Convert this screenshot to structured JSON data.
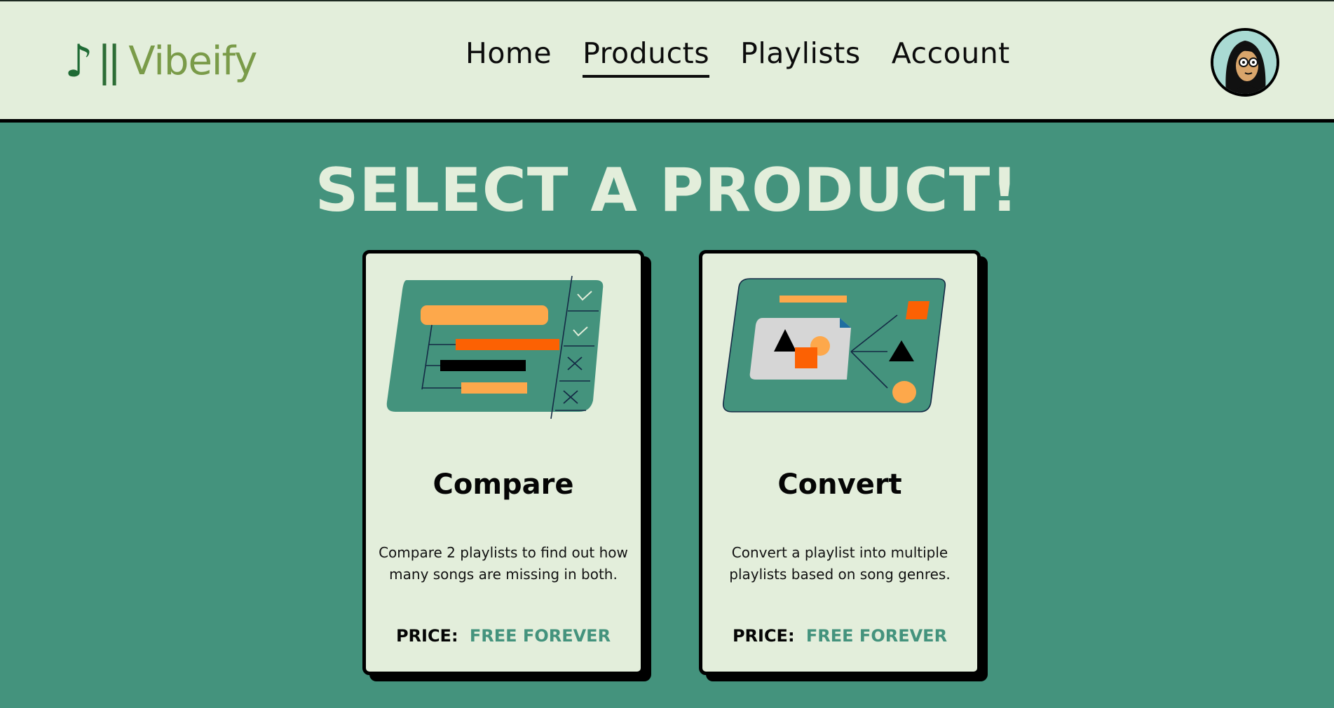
{
  "header": {
    "logo": {
      "note": "♪",
      "bars": "||",
      "name": "Vibeify"
    },
    "nav": [
      {
        "label": "Home"
      },
      {
        "label": "Products"
      },
      {
        "label": "Playlists"
      },
      {
        "label": "Account"
      }
    ],
    "active_tab": "Products",
    "avatar": "user-avatar"
  },
  "main": {
    "title": "SELECT A PRODUCT!",
    "cards": [
      {
        "title": "Compare",
        "description": "Compare 2 playlists to find out how many songs are missing in both.",
        "price_label": "PRICE:",
        "price_value": "FREE FOREVER",
        "illustration": "compare-illustration"
      },
      {
        "title": "Convert",
        "description": "Convert a playlist into multiple playlists based on song genres.",
        "price_label": "PRICE:",
        "price_value": "FREE FOREVER",
        "illustration": "convert-illustration"
      }
    ]
  },
  "colors": {
    "background": "#44937d",
    "header_bg": "#e3eedb",
    "card_bg": "#e3eedb",
    "accent_orange": "#fda84b",
    "accent_red_orange": "#fc6103",
    "logo_green": "#7a9b49",
    "price_green": "#44937d"
  }
}
